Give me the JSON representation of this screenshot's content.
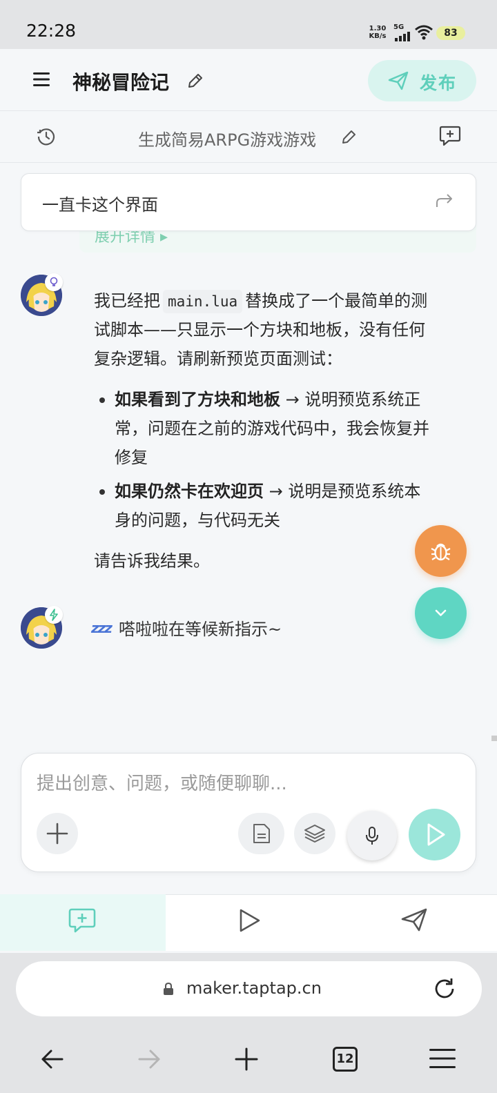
{
  "status_bar": {
    "time": "22:28",
    "net_speed_value": "1.30",
    "net_speed_unit": "KB/s",
    "network": "5G",
    "battery": "83"
  },
  "header": {
    "title": "神秘冒险记",
    "publish_label": "发布",
    "accent_color": "#5fcfbb"
  },
  "session": {
    "title": "生成简易ARPG游戏游戏"
  },
  "pinned_message": {
    "text": "一直卡这个界面",
    "collapsed_label": "展开详情"
  },
  "messages": [
    {
      "line1_before": "我已经把",
      "code": "main.lua",
      "line1_after": "替换成了一个最简单的测",
      "line2": "试脚本——只显示一个方块和地板，没有任何",
      "line3": "复杂逻辑。请刷新预览页面测试：",
      "bullets": [
        {
          "bold": "如果看到了方块和地板",
          "line1_rest": " → 说明预览系统正",
          "line2": "常，问题在之前的游戏代码中，我会恢复并",
          "line3": "修复"
        },
        {
          "bold": "如果仍然卡在欢迎页",
          "line1_rest": " → 说明是预览系统本",
          "line2": "身的问题，与代码无关"
        }
      ],
      "closing": "请告诉我结果。"
    },
    {
      "icon": "zzz",
      "text": "嗒啦啦在等候新指示~"
    }
  ],
  "composer": {
    "placeholder": "提出创意、问题，或随便聊聊..."
  },
  "browser": {
    "url": "maker.taptap.cn",
    "tab_count": "12"
  }
}
